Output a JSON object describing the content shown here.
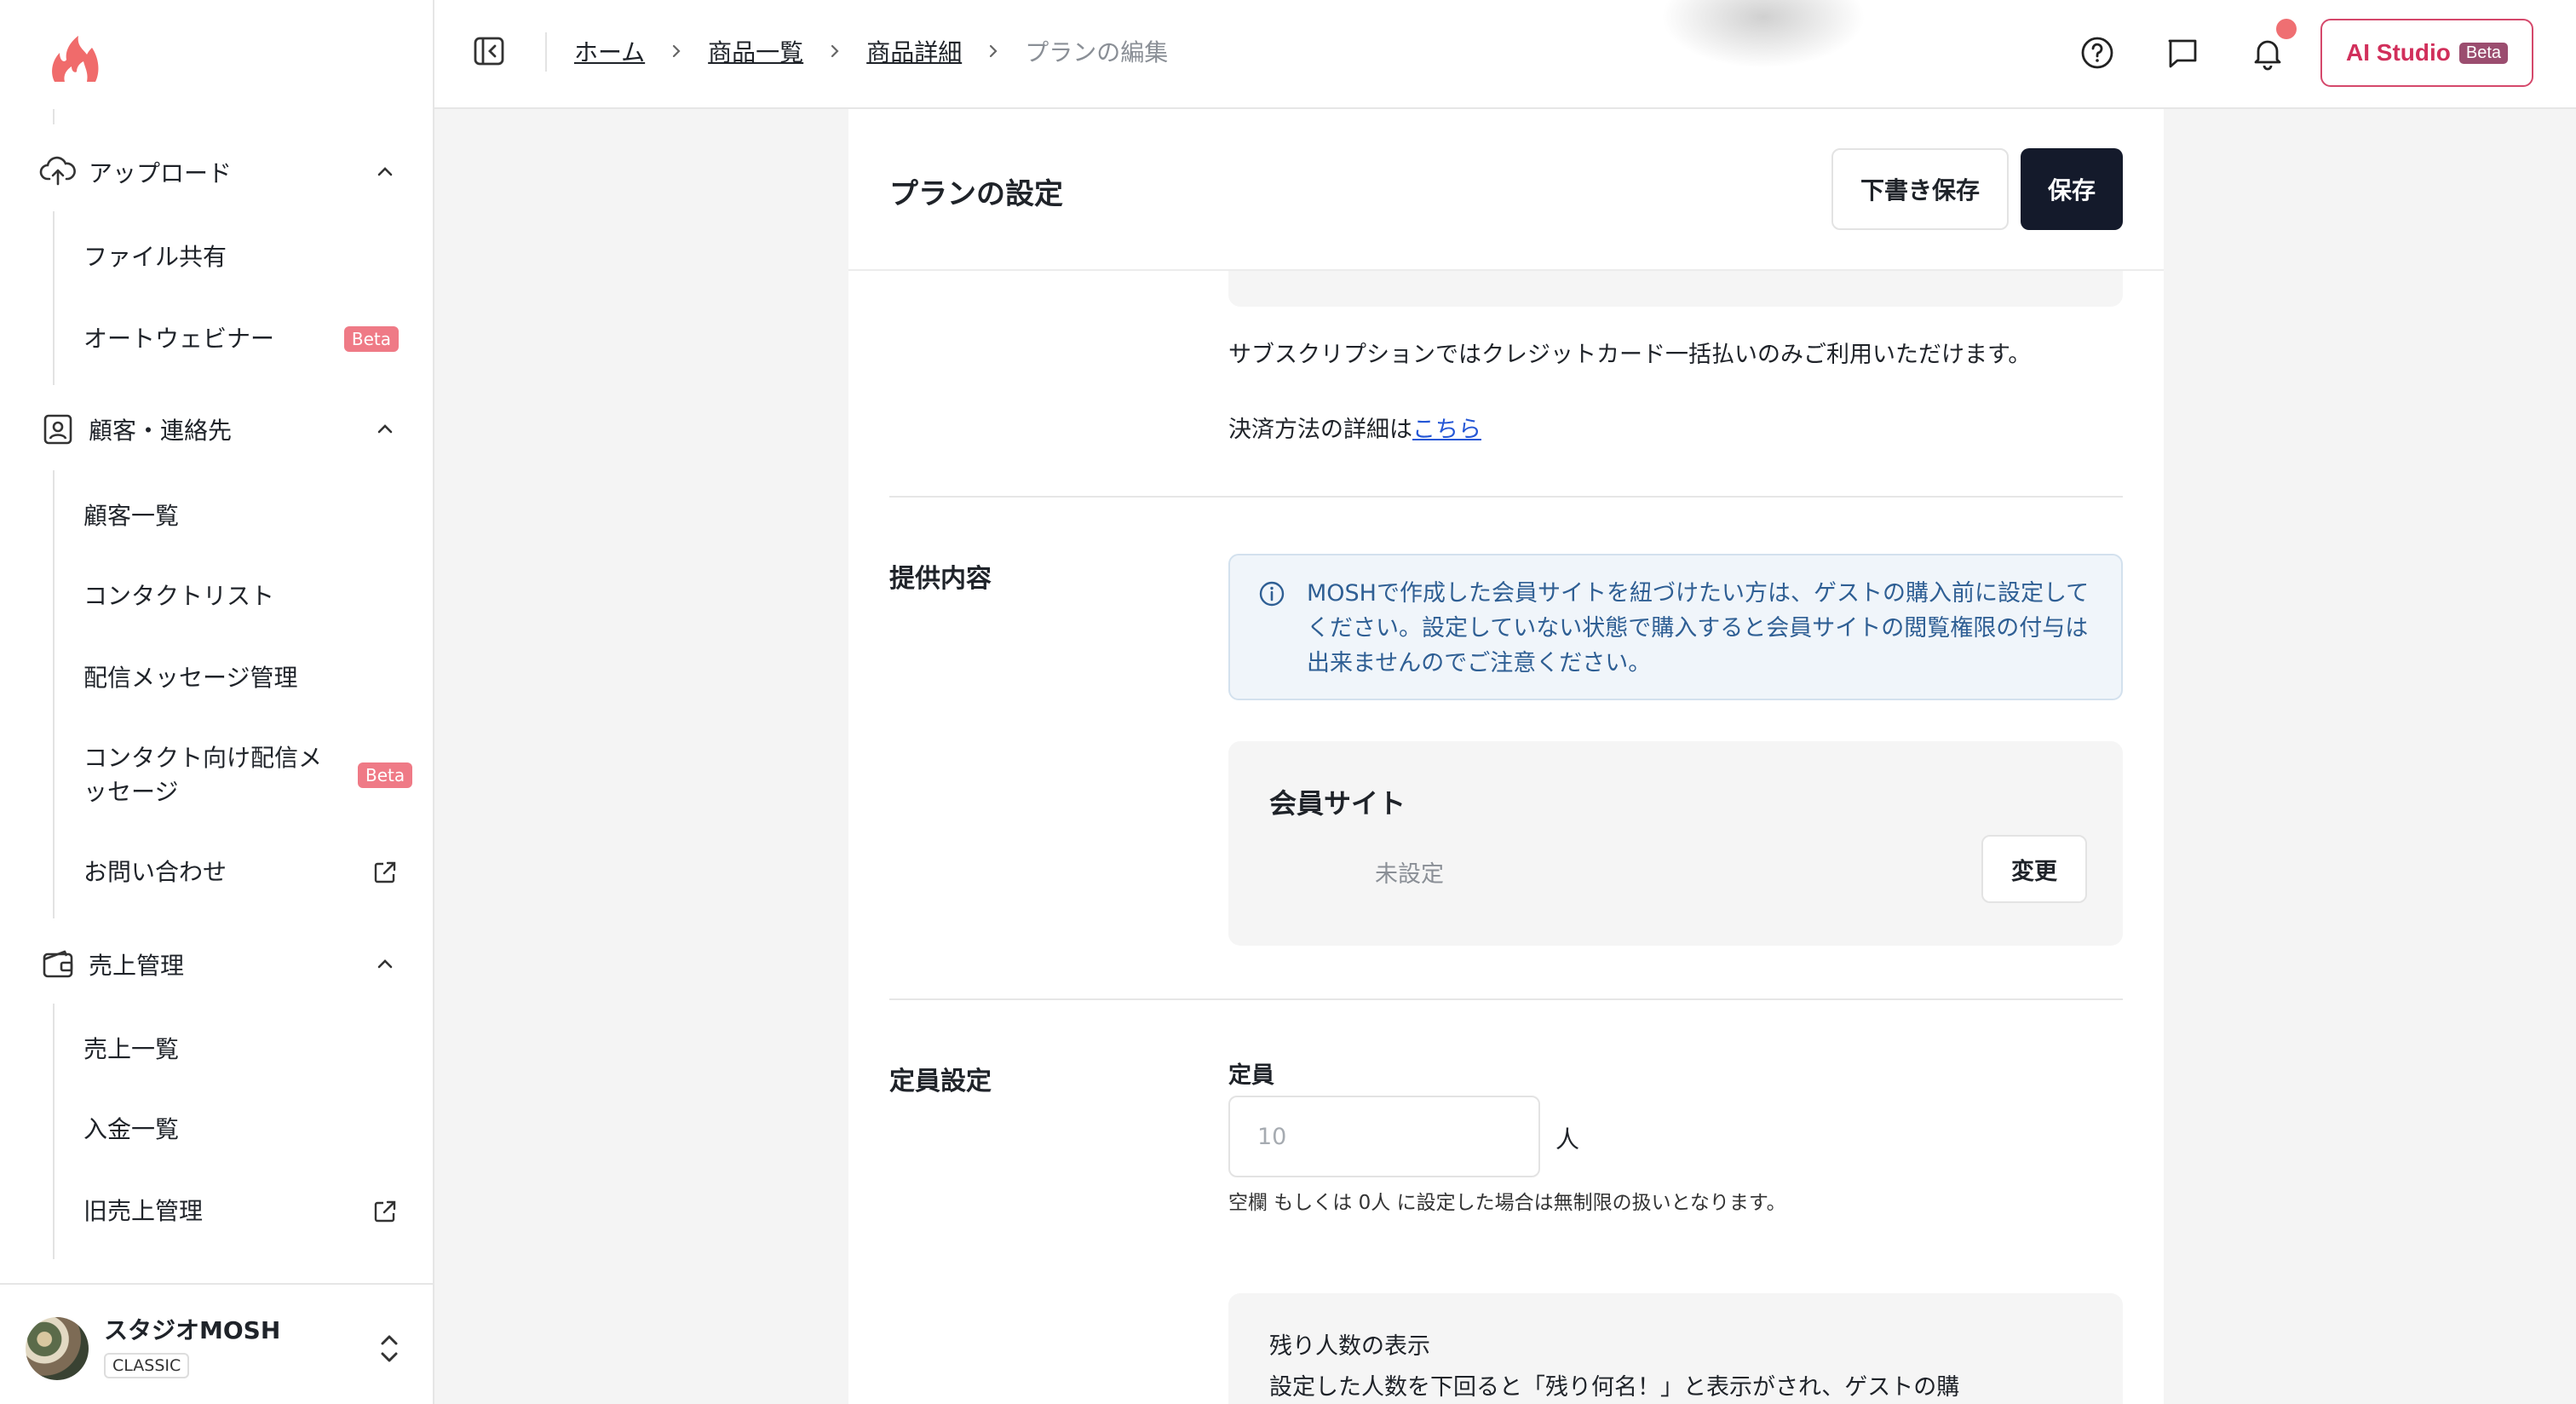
{
  "sidebar": {
    "sections": [
      {
        "label": "アップロード",
        "items": [
          {
            "label": "ファイル共有"
          },
          {
            "label": "オートウェビナー",
            "badge": "Beta"
          }
        ]
      },
      {
        "label": "顧客・連絡先",
        "items": [
          {
            "label": "顧客一覧"
          },
          {
            "label": "コンタクトリスト"
          },
          {
            "label": "配信メッセージ管理"
          },
          {
            "label": "コンタクト向け配信メッセージ",
            "badge": "Beta"
          },
          {
            "label": "お問い合わせ",
            "external": true
          }
        ]
      },
      {
        "label": "売上管理",
        "items": [
          {
            "label": "売上一覧"
          },
          {
            "label": "入金一覧"
          },
          {
            "label": "旧売上管理",
            "external": true
          }
        ]
      }
    ],
    "footer": {
      "org_name": "スタジオMOSH",
      "plan": "CLASSIC"
    }
  },
  "topbar": {
    "breadcrumbs": [
      "ホーム",
      "商品一覧",
      "商品詳細"
    ],
    "current": "プランの編集",
    "ai_studio": {
      "label": "AI Studio",
      "badge": "Beta"
    },
    "accent": "#d12f5b"
  },
  "page": {
    "title": "プランの設定",
    "draft_label": "下書き保存",
    "save_label": "保存",
    "subscription_note": "サブスクリプションではクレジットカード一括払いのみご利用いただけます。",
    "payment_detail_prefix": "決済方法の詳細は",
    "payment_detail_link": "こちら",
    "offering": {
      "title": "提供内容",
      "info": "MOSHで作成した会員サイトを紐づけたい方は、ゲストの購入前に設定してください。設定していない状態で購入すると会員サイトの閲覧権限の付与は出来ませんのでご注意ください。",
      "member_site_title": "会員サイト",
      "member_site_value": "未設定",
      "change_label": "変更"
    },
    "capacity": {
      "title": "定員設定",
      "label": "定員",
      "placeholder": "10",
      "unit": "人",
      "hint": "空欄 もしくは 0人 に設定した場合は無制限の扱いとなります。",
      "remaining_title": "残り人数の表示",
      "remaining_desc": "設定した人数を下回ると「残り何名！」と表示がされ、ゲストの購"
    }
  }
}
